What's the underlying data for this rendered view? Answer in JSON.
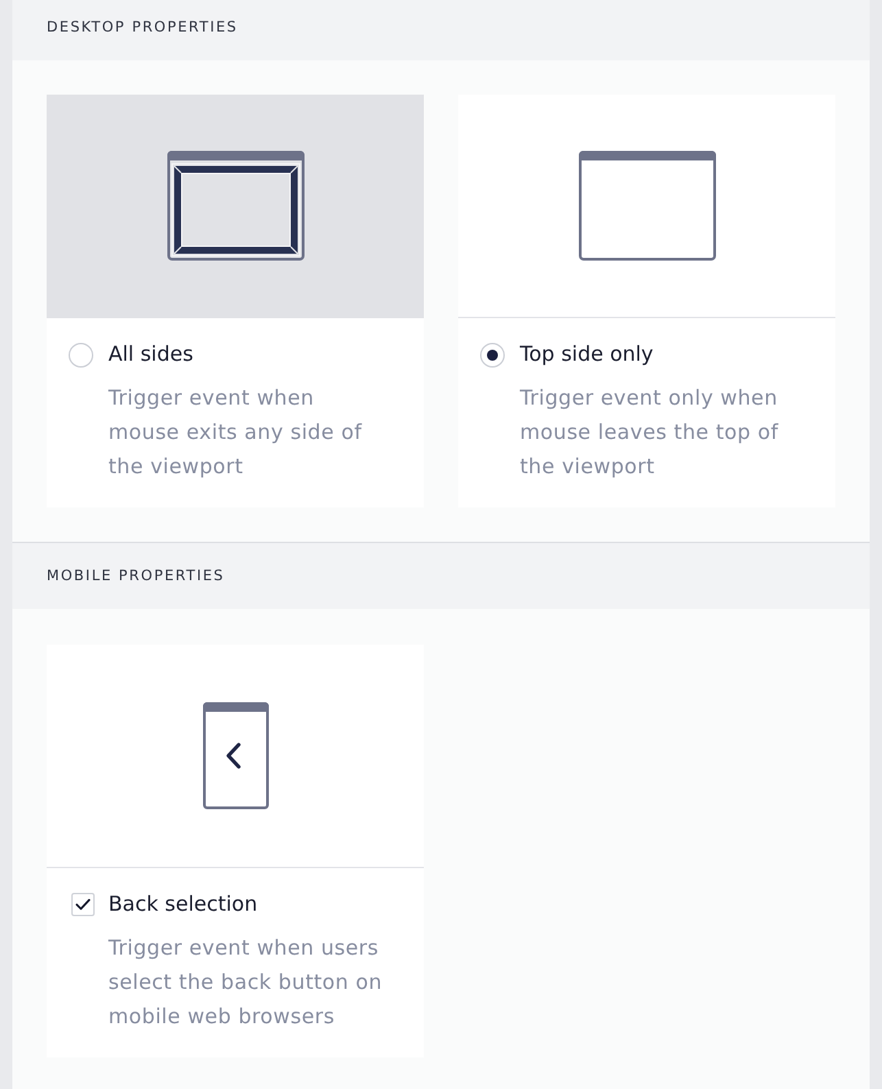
{
  "sections": [
    {
      "title": "DESKTOP PROPERTIES",
      "options": [
        {
          "kind": "radio",
          "preview": {
            "kind": "frame",
            "highlighted": true
          },
          "selected": false,
          "label": "All sides",
          "description": "Trigger event when mouse exits any side of the viewport"
        },
        {
          "kind": "radio",
          "preview": {
            "kind": "window",
            "highlighted": false
          },
          "selected": true,
          "label": "Top side only",
          "description": "Trigger event only when mouse leaves the top of the viewport"
        }
      ]
    },
    {
      "title": "MOBILE PROPERTIES",
      "options": [
        {
          "kind": "checkbox",
          "preview": {
            "kind": "phone",
            "highlighted": false
          },
          "checked": true,
          "label": "Back selection",
          "description": "Trigger event when users select the back button on mobile web browsers"
        }
      ]
    }
  ]
}
